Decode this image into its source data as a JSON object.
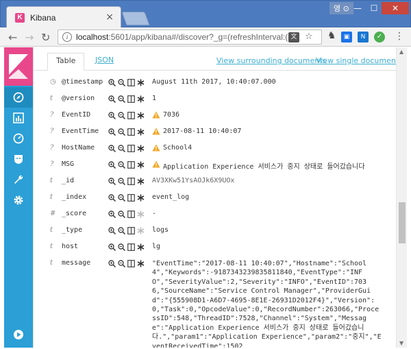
{
  "browser": {
    "tab_title": "Kibana",
    "ime_label": "영 ⊙",
    "url_host": "localhost",
    "url_rest": ":5601/app/kibana#/discover?_g=(refreshInterval:(..."
  },
  "sidebar": {
    "items": [
      "discover",
      "visualize",
      "dashboard",
      "timelion",
      "dev-tools",
      "management"
    ]
  },
  "doc": {
    "tabs": {
      "table": "Table",
      "json": "JSON"
    },
    "links": {
      "surrounding": "View surrounding documents",
      "single": "View single document"
    },
    "fields": [
      {
        "type": "clock",
        "name": "@timestamp",
        "value": "August 11th 2017, 10:40:07.000",
        "warning": false
      },
      {
        "type": "t",
        "name": "@version",
        "value": "1",
        "warning": false
      },
      {
        "type": "?",
        "name": "EventID",
        "value": "7036",
        "warning": true
      },
      {
        "type": "?",
        "name": "EventTime",
        "value": "2017-08-11 10:40:07",
        "warning": true
      },
      {
        "type": "?",
        "name": "HostName",
        "value": "School4",
        "warning": true
      },
      {
        "type": "?",
        "name": "MSG",
        "value": "Application Experience 서비스가 중지 상태로 들어갔습니다",
        "warning": true
      },
      {
        "type": "t",
        "name": "_id",
        "value": "AV3XKw51YsAOJk6X9UOx",
        "warning": false
      },
      {
        "type": "t",
        "name": "_index",
        "value": "event_log",
        "warning": false
      },
      {
        "type": "#",
        "name": "_score",
        "value": " -",
        "warning": false
      },
      {
        "type": "t",
        "name": "_type",
        "value": "logs",
        "warning": false
      },
      {
        "type": "t",
        "name": "host",
        "value": "lg",
        "warning": false
      }
    ],
    "message": {
      "type": "t",
      "name": "message",
      "value": "\"EventTime\":\"2017-08-11 10:40:07\",\"Hostname\":\"School4\",\"Keywords\":-9187343239835811840,\"EventType\":\"INFO\",\"SeverityValue\":2,\"Severity\":\"INFO\",\"EventID\":7036,\"SourceName\":\"Service Control Manager\",\"ProviderGuid\":\"{555908D1-A6D7-4695-8E1E-26931D2012F4}\",\"Version\":0,\"Task\":0,\"OpcodeValue\":0,\"RecordNumber\":263066,\"ProcessID\":548,\"ThreadID\":7528,\"Channel\":\"System\",\"Message\":\"Application Experience 서비스가 중지 상태로 들어갔습니다.\",\"param1\":\"Application Experience\",\"param2\":\"중지\",\"EventReceivedTime\":1502"
    }
  },
  "colors": {
    "sidebar": "#2b9fd6",
    "logo": "#e8478b",
    "link": "#3caed2",
    "warning": "#f5a623"
  }
}
